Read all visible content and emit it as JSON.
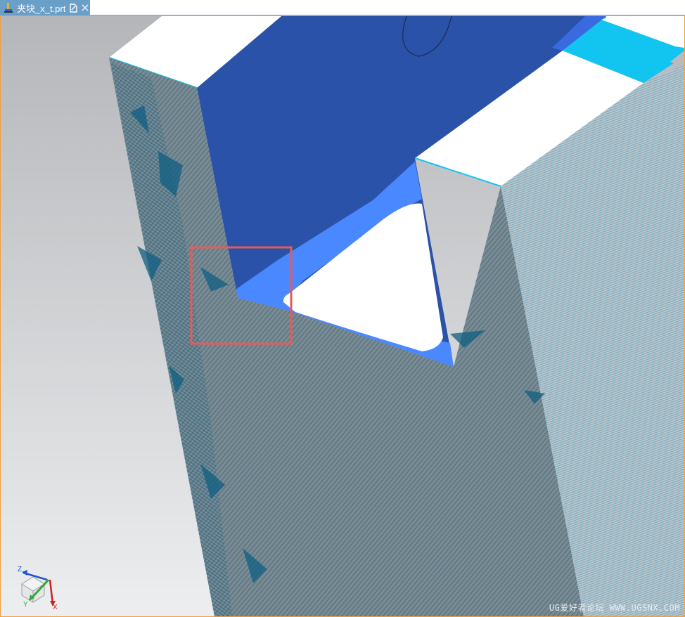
{
  "tab": {
    "label": "夹块_x_t.prt",
    "icon": "part-file-icon",
    "modified_icon": "document-modified-icon",
    "close_icon": "close-icon"
  },
  "viewport": {
    "highlight_color": "#e85a5a",
    "triad": {
      "z_label": "Z",
      "y_label": "Y",
      "x_label": "X",
      "z_color": "#2255cc",
      "y_color": "#33aa33",
      "x_color": "#cc2222"
    }
  },
  "watermark": "UG爱好者论坛 WWW.UGSNX.COM",
  "colors": {
    "background": "#c7c9cc",
    "top_face": "#ffffff",
    "pocket_wall": "#2a52a8",
    "fillet": "#4a88ff",
    "side_face": "#7e8a90",
    "right_face": "#b9c6cd",
    "accent_strip": "#12c4f0",
    "texture": "#0f5f82"
  }
}
